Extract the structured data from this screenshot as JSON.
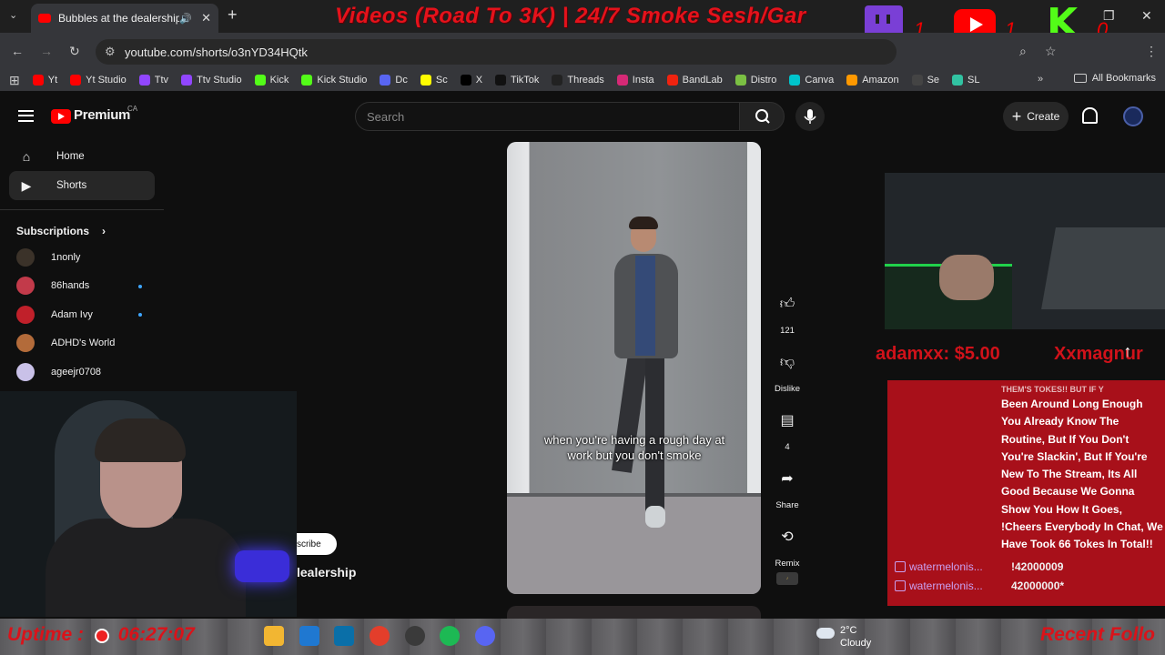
{
  "browser": {
    "tab_title": "Bubbles at the dealership -",
    "url": "youtube.com/shorts/o3nYD34HQtk",
    "new_tab": "+",
    "bookmarks": [
      {
        "label": "Yt",
        "color": "#ff0000"
      },
      {
        "label": "Yt Studio",
        "color": "#ff0000"
      },
      {
        "label": "Ttv",
        "color": "#9146ff"
      },
      {
        "label": "Ttv Studio",
        "color": "#9146ff"
      },
      {
        "label": "Kick",
        "color": "#53fc18"
      },
      {
        "label": "Kick Studio",
        "color": "#53fc18"
      },
      {
        "label": "Dc",
        "color": "#5865f2"
      },
      {
        "label": "Sc",
        "color": "#fffc00"
      },
      {
        "label": "X",
        "color": "#000000"
      },
      {
        "label": "TikTok",
        "color": "#111111"
      },
      {
        "label": "Threads",
        "color": "#222222"
      },
      {
        "label": "Insta",
        "color": "#d62976"
      },
      {
        "label": "BandLab",
        "color": "#f0230f"
      },
      {
        "label": "Distro",
        "color": "#7bc043"
      },
      {
        "label": "Canva",
        "color": "#00c4cc"
      },
      {
        "label": "Amazon",
        "color": "#ff9900"
      },
      {
        "label": "Se",
        "color": "#444444"
      },
      {
        "label": "SL",
        "color": "#31c3a2"
      }
    ],
    "all_bookmarks": "All Bookmarks"
  },
  "overlay": {
    "banner": "Videos (Road To 3K) | 24/7 Smoke Sesh/Gar",
    "twitch_count": "1",
    "youtube_count": "1",
    "kick_count": "0",
    "donation": "adamxx: $5.00",
    "donation_next": "Xxmagnur",
    "uptime_label": "Uptime :",
    "uptime_value": "06:27:07",
    "recent": "Recent Follo",
    "red_panel_lines": [
      "THEM'S TOKES!! BUT IF Y",
      "Been Around Long Enough",
      "You Already Know The",
      "Routine, But If You Don't",
      "You're Slackin', But If You're",
      "New To The Stream, Its All",
      "Good Because We Gonna",
      "Show You How It Goes,",
      "!Cheers Everybody In Chat, We",
      "Have Took 66 Tokes In Total!!"
    ],
    "chat": [
      {
        "user": "watermelonis...",
        "msg": "!42000009"
      },
      {
        "user": "watermelonis...",
        "msg": "42000000*"
      }
    ]
  },
  "youtube": {
    "logo": "Premium",
    "region": "CA",
    "search_placeholder": "Search",
    "create": "Create",
    "nav": [
      {
        "label": "Home",
        "icon": "home-icon"
      },
      {
        "label": "Shorts",
        "icon": "shorts-icon"
      }
    ],
    "subscriptions_label": "Subscriptions",
    "subscriptions": [
      {
        "name": "1nonly",
        "color": "#3b3229",
        "dot": false
      },
      {
        "name": "86hands",
        "color": "#c23a4a",
        "dot": true
      },
      {
        "name": "Adam Ivy",
        "color": "#c0202a",
        "dot": true
      },
      {
        "name": "ADHD's World",
        "color": "#b36b3a",
        "dot": false
      },
      {
        "name": "ageejr0708",
        "color": "#c9c1e8",
        "dot": false
      }
    ],
    "short": {
      "caption": "when you're having a rough day at work but you don't smoke",
      "likes": "121",
      "dislike": "Dislike",
      "comments": "4",
      "share": "Share",
      "remix": "Remix",
      "subscribe_fragment": "scribe",
      "title_fragment": "lealership"
    }
  },
  "taskbar": {
    "temp": "2°C",
    "condition": "Cloudy",
    "apps": [
      {
        "name": "file-explorer-icon",
        "color": "#f2b632"
      },
      {
        "name": "store-icon",
        "color": "#1f78d1"
      },
      {
        "name": "app-icon",
        "color": "#0a6fa8"
      },
      {
        "name": "chrome-icon",
        "color": "#e33e2b"
      },
      {
        "name": "obs-icon",
        "color": "#3a3a3a"
      },
      {
        "name": "spotify-icon",
        "color": "#1db954"
      },
      {
        "name": "discord-icon",
        "color": "#5865f2"
      }
    ]
  }
}
